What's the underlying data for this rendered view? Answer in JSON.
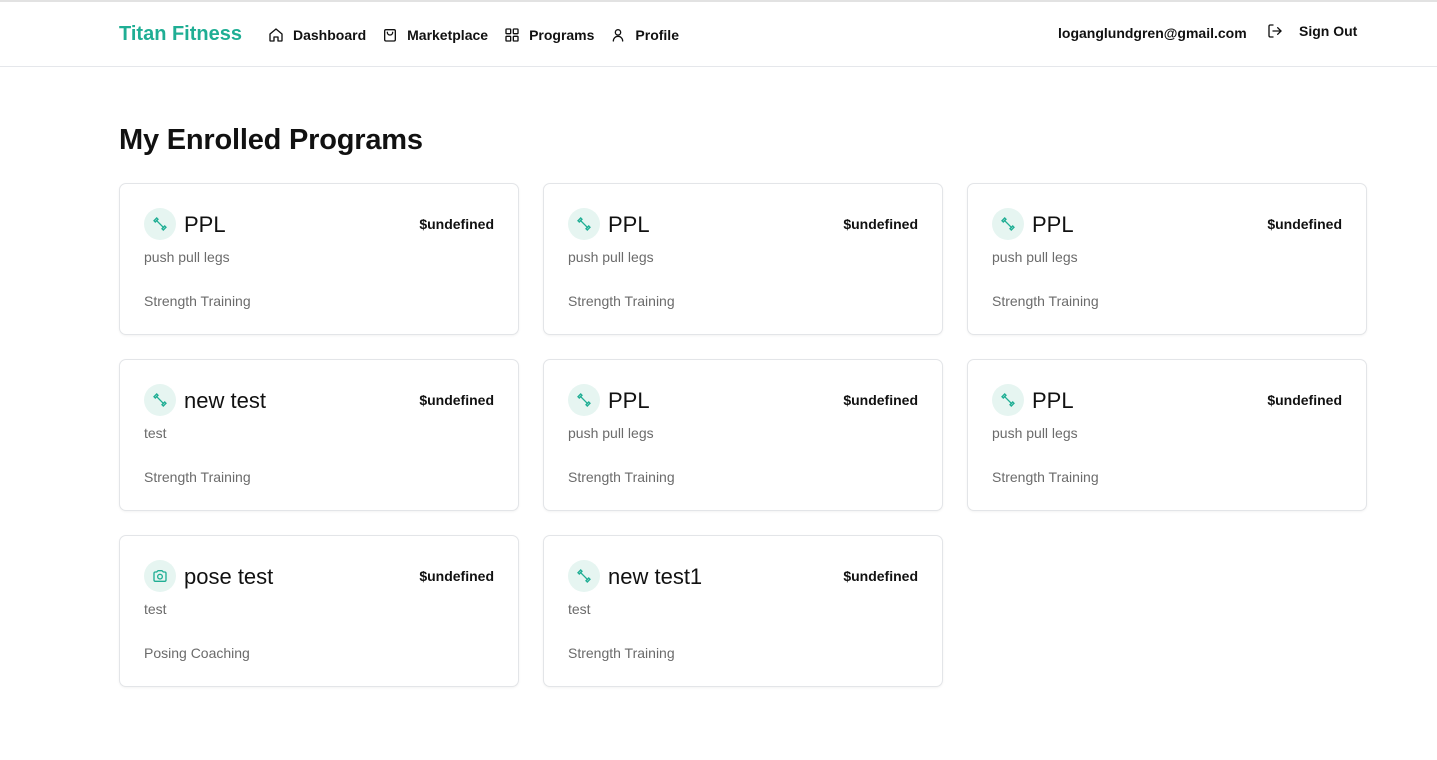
{
  "app": {
    "brand": "Titan Fitness"
  },
  "nav": {
    "items": [
      {
        "label": "Dashboard",
        "icon": "home-icon"
      },
      {
        "label": "Marketplace",
        "icon": "shopping-bag-icon"
      },
      {
        "label": "Programs",
        "icon": "grid-icon"
      },
      {
        "label": "Profile",
        "icon": "user-icon"
      }
    ],
    "user_email": "loganglundgren@gmail.com",
    "sign_out_label": "Sign Out"
  },
  "page": {
    "title": "My Enrolled Programs"
  },
  "colors": {
    "accent": "#1fae94",
    "icon_bg": "#e6f5f1"
  },
  "programs": [
    {
      "title": "PPL",
      "price": "$undefined",
      "description": "push pull legs",
      "category": "Strength Training",
      "icon": "dumbbell-icon"
    },
    {
      "title": "PPL",
      "price": "$undefined",
      "description": "push pull legs",
      "category": "Strength Training",
      "icon": "dumbbell-icon"
    },
    {
      "title": "PPL",
      "price": "$undefined",
      "description": "push pull legs",
      "category": "Strength Training",
      "icon": "dumbbell-icon"
    },
    {
      "title": "new test",
      "price": "$undefined",
      "description": "test",
      "category": "Strength Training",
      "icon": "dumbbell-icon"
    },
    {
      "title": "PPL",
      "price": "$undefined",
      "description": "push pull legs",
      "category": "Strength Training",
      "icon": "dumbbell-icon"
    },
    {
      "title": "PPL",
      "price": "$undefined",
      "description": "push pull legs",
      "category": "Strength Training",
      "icon": "dumbbell-icon"
    },
    {
      "title": "pose test",
      "price": "$undefined",
      "description": "test",
      "category": "Posing Coaching",
      "icon": "camera-icon"
    },
    {
      "title": "new test1",
      "price": "$undefined",
      "description": "test",
      "category": "Strength Training",
      "icon": "dumbbell-icon"
    }
  ]
}
